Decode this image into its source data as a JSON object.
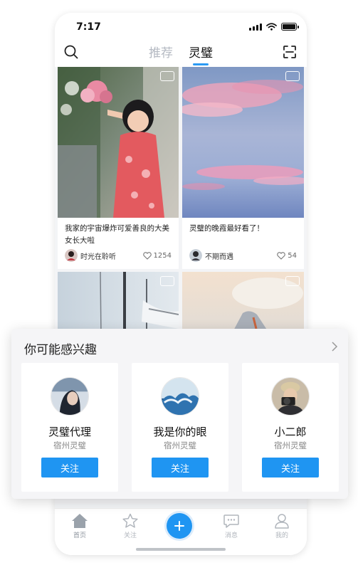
{
  "status_bar": {
    "time": "7:17"
  },
  "header": {
    "tabs": [
      {
        "label": "推荐"
      },
      {
        "label": "灵璧"
      }
    ]
  },
  "feed": {
    "cards": [
      {
        "title": "我家的宇宙爆炸可爱善良的大美女长大啦",
        "author": "时光在聆听",
        "likes": "1254",
        "badge": "image"
      },
      {
        "title": "灵璧的晚霞最好看了！",
        "author": "不期而遇",
        "likes": "54",
        "badge": "video"
      },
      {
        "title": "",
        "author": "",
        "likes": "",
        "badge": "video"
      },
      {
        "title": "",
        "author": "",
        "likes": "",
        "badge": "video"
      }
    ]
  },
  "suggestions": {
    "title": "你可能感兴趣",
    "users": [
      {
        "name": "灵璧代理",
        "location": "宿州灵璧",
        "follow_label": "关注"
      },
      {
        "name": "我是你的眼",
        "location": "宿州灵璧",
        "follow_label": "关注"
      },
      {
        "name": "小二郎",
        "location": "宿州灵璧",
        "follow_label": "关注"
      }
    ]
  },
  "tabbar": {
    "items": [
      {
        "label": "首页",
        "icon": "home-icon",
        "active": true
      },
      {
        "label": "关注",
        "icon": "star-icon",
        "active": false
      },
      {
        "label": "",
        "icon": "plus-icon",
        "active": false
      },
      {
        "label": "消息",
        "icon": "chat-icon",
        "active": false
      },
      {
        "label": "我的",
        "icon": "user-icon",
        "active": false
      }
    ]
  },
  "colors": {
    "accent": "#1f95f2",
    "tab_inactive": "#b4b9c2",
    "feed_bg": "#f3f4f6",
    "sheet_bg": "#f5f5f7"
  }
}
